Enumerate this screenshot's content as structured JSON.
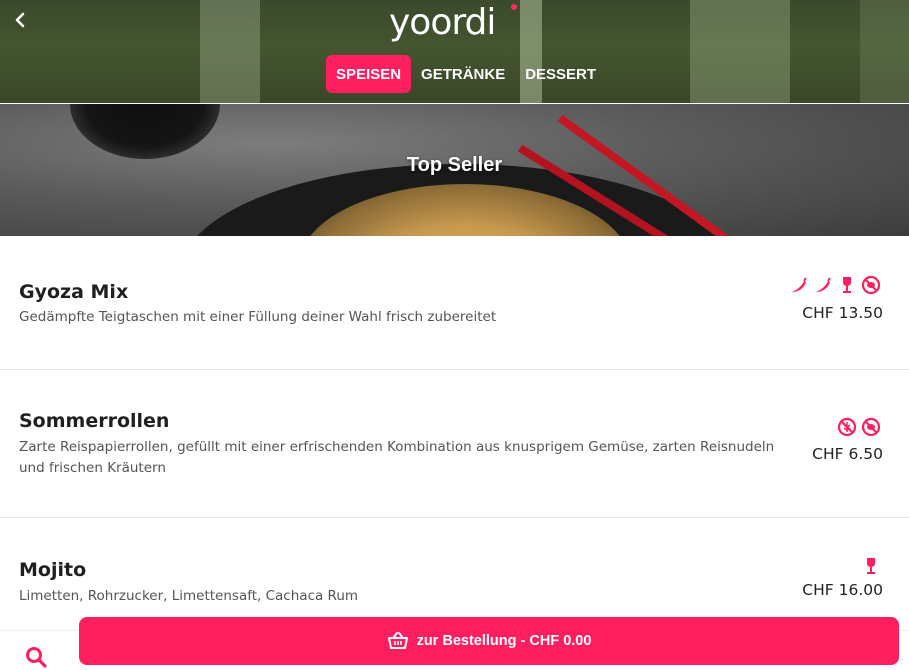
{
  "header": {
    "logo_text": "yoordi",
    "tabs": [
      {
        "label": "SPEISEN",
        "active": true
      },
      {
        "label": "GETRÄNKE",
        "active": false
      },
      {
        "label": "DESSERT",
        "active": false
      }
    ],
    "back_icon": "chevron-left-icon"
  },
  "category": {
    "title": "Top Seller"
  },
  "items": [
    {
      "name": "Gyoza Mix",
      "description": "Gedämpfte Teigtaschen mit einer Füllung deiner Wahl frisch zubereitet",
      "price": "CHF 13.50",
      "icons": [
        "chili-icon",
        "chili-icon",
        "wine-glass-icon",
        "no-meat-icon"
      ]
    },
    {
      "name": "Sommerrollen",
      "description": "Zarte Reispapierrollen, gefüllt mit einer erfrischenden Kombination aus knusprigem Gemüse, zarten Reisnudeln und frischen Kräutern",
      "price": "CHF 6.50",
      "icons": [
        "no-gluten-icon",
        "no-meat-icon"
      ]
    },
    {
      "name": "Mojito",
      "description": "Limetten, Rohrzucker, Limettensaft, Cachaca Rum",
      "price": "CHF 16.00",
      "icons": [
        "wine-glass-icon"
      ]
    }
  ],
  "bottom": {
    "order_label": "zur Bestellung - CHF 0.00",
    "search_icon": "search-icon",
    "basket_icon": "basket-icon"
  },
  "colors": {
    "accent": "#ff1f5e",
    "header_bg": "#3b4a2c"
  }
}
